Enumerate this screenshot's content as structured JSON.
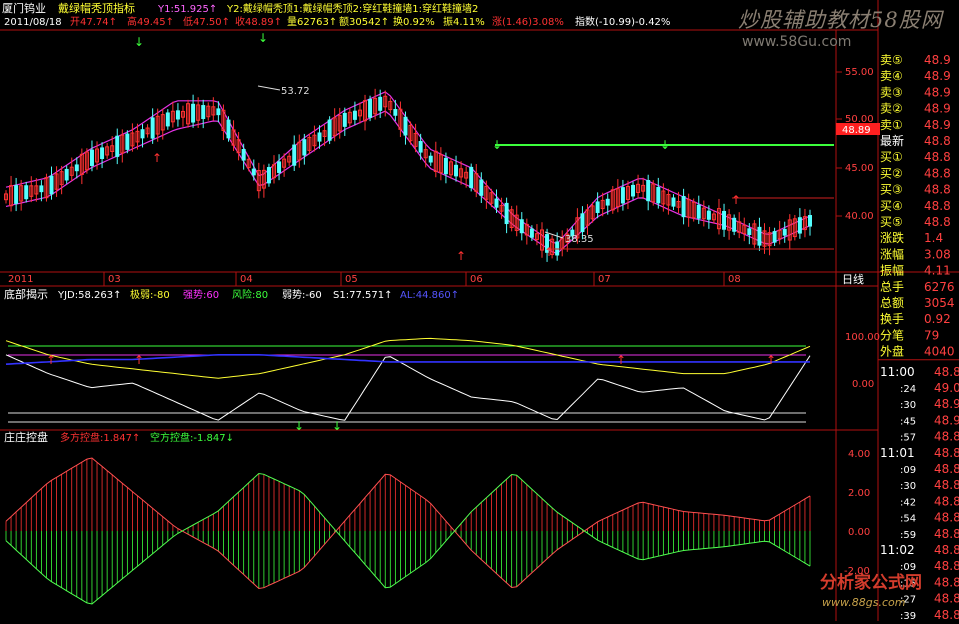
{
  "stock": {
    "name": "厦门钨业",
    "indicator": "戴绿帽秃顶指标",
    "y1": "Y1:51.925↑",
    "y2": "Y2:戴绿帽秃顶1:戴绿帽秃顶2:穿红鞋撞墙1:穿红鞋撞墙2"
  },
  "quote": {
    "date": "2011/08/18",
    "open": "开47.74↑",
    "high": "高49.45↑",
    "low": "低47.50↑",
    "close": "收48.89↑",
    "vol": "量62763↑",
    "amt": "额30542↑",
    "turn": "换0.92%",
    "amp": "振4.11%",
    "chg": "涨(1.46)3.08%",
    "idx": "指数(-10.99)-0.42%"
  },
  "price_axis": {
    "labels": [
      "55.00",
      "50.00",
      "45.00",
      "40.00"
    ]
  },
  "annotations": {
    "high": "53.72",
    "low": "38.35",
    "last": "48.89"
  },
  "month_axis": {
    "labels": [
      "2011",
      "03",
      "04",
      "05",
      "06",
      "07",
      "08"
    ],
    "period": "日线"
  },
  "panel2": {
    "title": "底部揭示",
    "yjd": "YJD:58.263↑",
    "jr": "极弱:-80",
    "qs": "强势:60",
    "fx": "风险:80",
    "rs": "弱势:-60",
    "s1": "S1:77.571↑",
    "a1": "AL:44.860↑",
    "axis": [
      "100.00",
      "0.00"
    ]
  },
  "panel3": {
    "title": "庄庄控盘",
    "duo": "多方控盘:1.847↑",
    "kong": "空方控盘:-1.847↓",
    "axis": [
      "4.00",
      "2.00",
      "0.00",
      "-2.00"
    ]
  },
  "order_book": {
    "sells": [
      {
        "label": "卖⑤",
        "price": "48.9"
      },
      {
        "label": "卖④",
        "price": "48.9"
      },
      {
        "label": "卖③",
        "price": "48.9"
      },
      {
        "label": "卖②",
        "price": "48.9"
      },
      {
        "label": "卖①",
        "price": "48.9"
      }
    ],
    "latest": {
      "label": "最新",
      "price": "48.8"
    },
    "buys": [
      {
        "label": "买①",
        "price": "48.8"
      },
      {
        "label": "买②",
        "price": "48.8"
      },
      {
        "label": "买③",
        "price": "48.8"
      },
      {
        "label": "买④",
        "price": "48.8"
      },
      {
        "label": "买⑤",
        "price": "48.8"
      }
    ],
    "stats": [
      {
        "label": "涨跌",
        "value": "1.4"
      },
      {
        "label": "涨幅",
        "value": "3.08"
      },
      {
        "label": "振幅",
        "value": "4.11"
      },
      {
        "label": "总手",
        "value": "6276"
      },
      {
        "label": "总额",
        "value": "3054"
      },
      {
        "label": "换手",
        "value": "0.92"
      },
      {
        "label": "分笔",
        "value": "79"
      },
      {
        "label": "外盘",
        "value": "4040"
      }
    ],
    "ticks": [
      {
        "time": "11:00",
        "price": "48.8"
      },
      {
        "time": ":24",
        "price": "49.0"
      },
      {
        "time": ":30",
        "price": "48.9"
      },
      {
        "time": ":45",
        "price": "48.9"
      },
      {
        "time": ":57",
        "price": "48.8"
      },
      {
        "time": "11:01",
        "price": "48.8"
      },
      {
        "time": ":09",
        "price": "48.8"
      },
      {
        "time": ":30",
        "price": "48.8"
      },
      {
        "time": ":42",
        "price": "48.8"
      },
      {
        "time": ":54",
        "price": "48.8"
      },
      {
        "time": ":59",
        "price": "48.8"
      },
      {
        "time": "11:02",
        "price": "48.8"
      },
      {
        "time": ":09",
        "price": "48.8"
      },
      {
        "time": ":15",
        "price": "48.8"
      },
      {
        "time": ":27",
        "price": "48.8"
      },
      {
        "time": ":39",
        "price": "48.8"
      }
    ]
  },
  "watermarks": {
    "top": "炒股辅助教材58股网",
    "top_url": "www.58Gu.com",
    "bottom": "分析家公式网",
    "bottom_url": "www.88gs.com"
  },
  "colors": {
    "up": "#ff3232",
    "down": "#54ffff",
    "green": "#3cff3c",
    "magenta": "#e632e6",
    "yellow": "#ffff33",
    "blue": "#3333ff",
    "white": "#ffffff",
    "axis": "#b01010"
  },
  "chart_data": [
    {
      "type": "line",
      "title": "戴绿帽秃顶指标",
      "x": [
        0,
        10,
        20,
        30,
        40,
        50,
        60,
        70,
        80,
        90,
        100,
        110,
        120,
        130,
        140,
        150,
        160,
        170,
        180,
        190
      ],
      "ylim": [
        36,
        57
      ],
      "series": [
        {
          "name": "Y1",
          "values": [
            43,
            44,
            47,
            49,
            52,
            52,
            44,
            48,
            51,
            53,
            47,
            45,
            40,
            37,
            42,
            44,
            42,
            40,
            38,
            40
          ]
        },
        {
          "name": "Y2",
          "values": [
            41,
            42,
            45,
            47,
            49,
            50,
            43,
            46,
            49,
            51,
            45,
            43,
            39,
            36,
            40,
            42,
            40,
            39,
            37,
            39
          ]
        }
      ]
    },
    {
      "type": "line",
      "title": "底部揭示",
      "ylim": [
        -100,
        120
      ],
      "series": [
        {
          "name": "YJD",
          "values": [
            60,
            20,
            -10,
            0,
            -40,
            -80,
            -20,
            -60,
            -80,
            60,
            10,
            -30,
            -40,
            -80,
            10,
            -20,
            -10,
            -60,
            -80,
            58
          ]
        },
        {
          "name": "S1",
          "values": [
            90,
            60,
            40,
            30,
            20,
            10,
            20,
            40,
            60,
            90,
            95,
            90,
            80,
            60,
            40,
            30,
            20,
            20,
            40,
            78
          ]
        },
        {
          "name": "AL",
          "values": [
            40,
            45,
            50,
            50,
            55,
            60,
            60,
            55,
            50,
            45,
            45,
            45,
            45,
            45,
            45,
            45,
            45,
            45,
            45,
            45
          ]
        }
      ]
    },
    {
      "type": "bar",
      "title": "庄庄控盘",
      "ylim": [
        -4.5,
        4.5
      ],
      "series": [
        {
          "name": "多方控盘",
          "values": [
            0.5,
            2.5,
            3.8,
            2,
            0.2,
            -1,
            -3,
            -2,
            0.5,
            3,
            1.5,
            -1,
            -3,
            -1,
            0.5,
            1.5,
            1,
            0.8,
            0.5,
            1.8
          ]
        }
      ]
    }
  ]
}
